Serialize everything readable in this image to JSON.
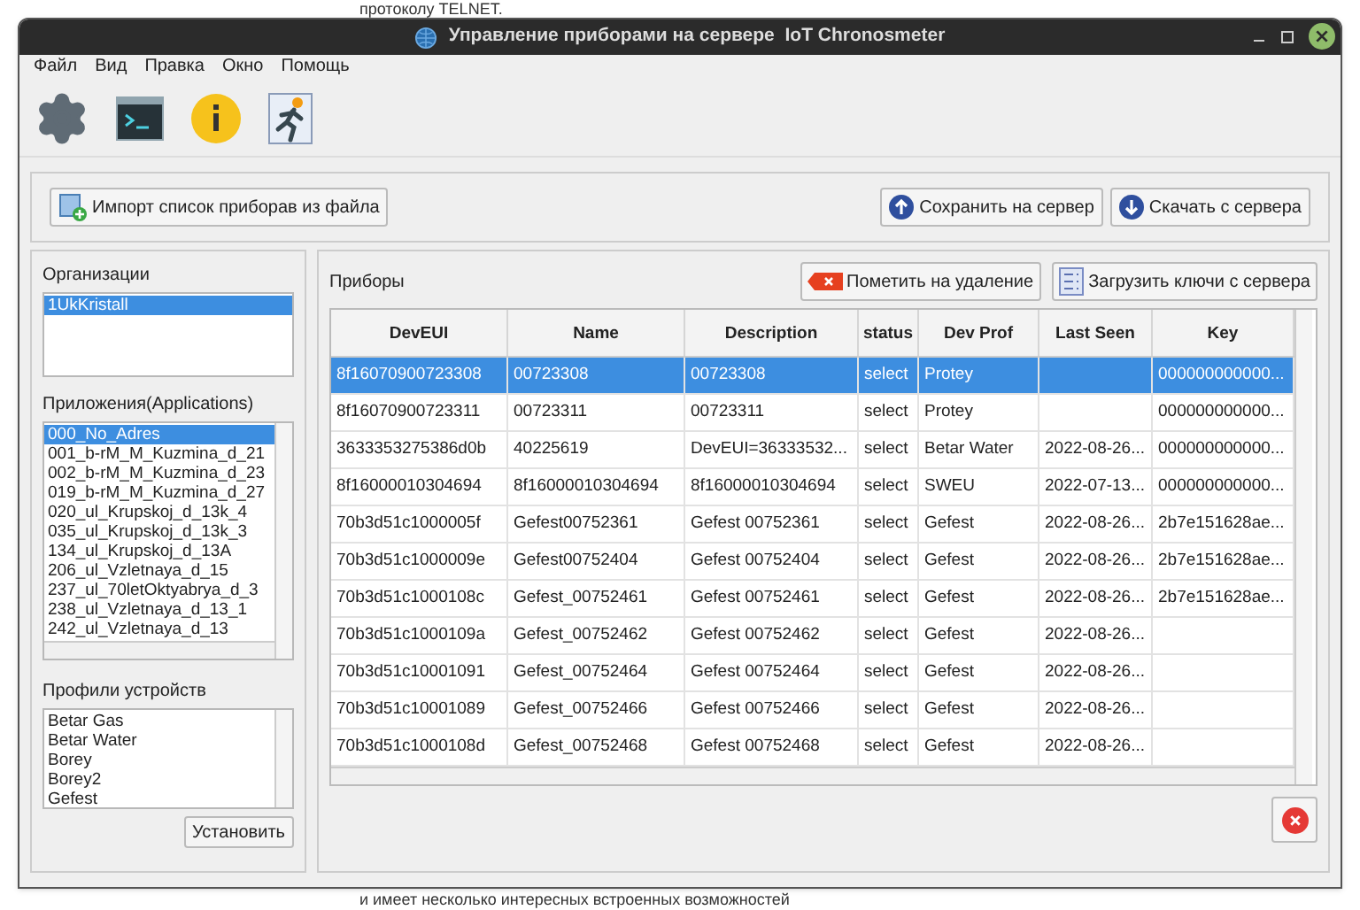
{
  "background_text": {
    "top": "протоколу TELNET.",
    "bottom": "и имеет несколько интересных встроенных возможностей"
  },
  "window": {
    "title": "Управление приборами на сервере  IoT Chronosmeter"
  },
  "menu": [
    "Файл",
    "Вид",
    "Правка",
    "Окно",
    "Помощь"
  ],
  "top_buttons": {
    "import": "Импорт список приборав из файла",
    "save": "Сохранить на сервер",
    "download": "Скачать с сервера"
  },
  "organizations": {
    "label": "Организации",
    "items": [
      {
        "text": "1UkKristall",
        "selected": true
      }
    ]
  },
  "applications": {
    "label": "Приложения(Applications)",
    "items": [
      {
        "text": "000_No_Adres",
        "selected": true
      },
      {
        "text": "001_b-rM_M_Kuzmina_d_21",
        "selected": false
      },
      {
        "text": "002_b-rM_M_Kuzmina_d_23",
        "selected": false
      },
      {
        "text": "019_b-rM_M_Kuzmina_d_27",
        "selected": false
      },
      {
        "text": "020_ul_Krupskoj_d_13k_4",
        "selected": false
      },
      {
        "text": "035_ul_Krupskoj_d_13k_3",
        "selected": false
      },
      {
        "text": "134_ul_Krupskoj_d_13A",
        "selected": false
      },
      {
        "text": "206_ul_Vzletnaya_d_15",
        "selected": false
      },
      {
        "text": "237_ul_70letOktyabrya_d_3",
        "selected": false
      },
      {
        "text": "238_ul_Vzletnaya_d_13_1",
        "selected": false
      },
      {
        "text": "242_ul_Vzletnaya_d_13",
        "selected": false
      }
    ]
  },
  "profiles": {
    "label": "Профили устройств",
    "items": [
      {
        "text": "Betar Gas",
        "selected": false
      },
      {
        "text": "Betar Water",
        "selected": false
      },
      {
        "text": "Borey",
        "selected": false
      },
      {
        "text": "Borey2",
        "selected": false
      },
      {
        "text": "Gefest",
        "selected": false
      }
    ],
    "button": "Установить"
  },
  "devices": {
    "label": "Приборы",
    "mark_delete": "Пометить на удаление",
    "load_keys": "Загрузить ключи с сервера",
    "columns": [
      "DevEUI",
      "Name",
      "Description",
      "status",
      "Dev Prof",
      "Last Seen",
      "Key"
    ],
    "rows": [
      {
        "cells": [
          "8f16070900723308",
          "00723308",
          "00723308",
          "select",
          "Protey",
          "",
          "000000000000..."
        ],
        "selected": true
      },
      {
        "cells": [
          "8f16070900723311",
          "00723311",
          "00723311",
          "select",
          "Protey",
          "",
          "000000000000..."
        ],
        "selected": false
      },
      {
        "cells": [
          "3633353275386d0b",
          "40225619",
          "DevEUI=36333532...",
          "select",
          "Betar Water",
          "2022-08-26...",
          "000000000000..."
        ],
        "selected": false
      },
      {
        "cells": [
          "8f16000010304694",
          "8f16000010304694",
          "8f16000010304694",
          "select",
          "SWEU",
          "2022-07-13...",
          "000000000000..."
        ],
        "selected": false
      },
      {
        "cells": [
          "70b3d51c1000005f",
          "Gefest00752361",
          "Gefest 00752361",
          "select",
          "Gefest",
          "2022-08-26...",
          "2b7e151628ae..."
        ],
        "selected": false
      },
      {
        "cells": [
          "70b3d51c1000009e",
          "Gefest00752404",
          "Gefest 00752404",
          "select",
          "Gefest",
          "2022-08-26...",
          "2b7e151628ae..."
        ],
        "selected": false
      },
      {
        "cells": [
          "70b3d51c1000108c",
          "Gefest_00752461",
          "Gefest 00752461",
          "select",
          "Gefest",
          "2022-08-26...",
          "2b7e151628ae..."
        ],
        "selected": false
      },
      {
        "cells": [
          "70b3d51c1000109a",
          "Gefest_00752462",
          "Gefest 00752462",
          "select",
          "Gefest",
          "2022-08-26...",
          ""
        ],
        "selected": false
      },
      {
        "cells": [
          "70b3d51c10001091",
          "Gefest_00752464",
          "Gefest 00752464",
          "select",
          "Gefest",
          "2022-08-26...",
          ""
        ],
        "selected": false
      },
      {
        "cells": [
          "70b3d51c10001089",
          "Gefest_00752466",
          "Gefest 00752466",
          "select",
          "Gefest",
          "2022-08-26...",
          ""
        ],
        "selected": false
      },
      {
        "cells": [
          "70b3d51c1000108d",
          "Gefest_00752468",
          "Gefest 00752468",
          "select",
          "Gefest",
          "2022-08-26...",
          ""
        ],
        "selected": false
      }
    ]
  }
}
